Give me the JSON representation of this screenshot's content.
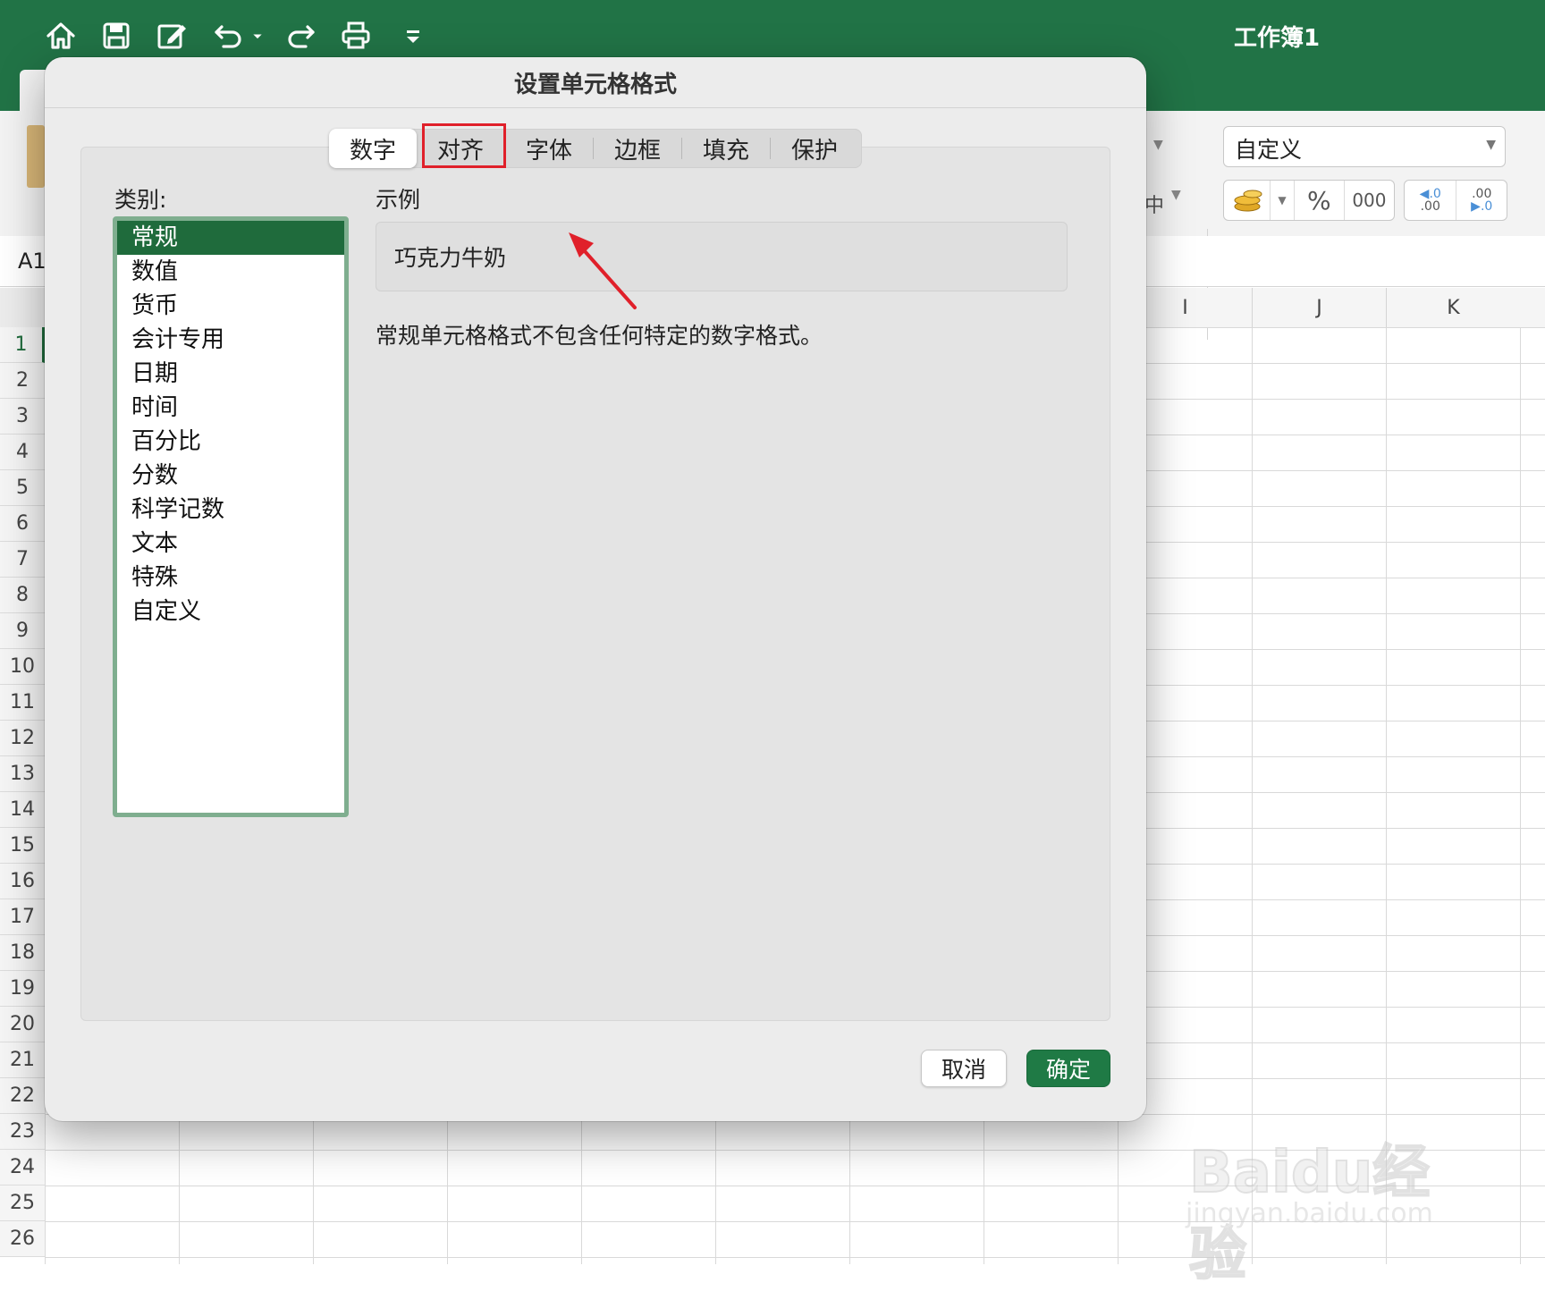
{
  "window": {
    "title": "工作簿1",
    "quick_access": [
      "home-icon",
      "save-icon",
      "edit-icon",
      "undo-icon",
      "redo-icon",
      "print-icon",
      "customize-icon"
    ]
  },
  "ribbon": {
    "number_format_value": "自定义",
    "buttons": [
      "accounting-icon",
      "%",
      "000",
      "increase-decimal-icon",
      "decrease-decimal-icon"
    ],
    "fragment_center": "中"
  },
  "formula_bar": {
    "name_box": "A1"
  },
  "grid": {
    "columns": [
      "I",
      "J",
      "K"
    ],
    "rows": [
      "1",
      "2",
      "3",
      "4",
      "5",
      "6",
      "7",
      "8",
      "9",
      "10",
      "11",
      "12",
      "13",
      "14",
      "15",
      "16",
      "17",
      "18",
      "19",
      "20",
      "21",
      "22",
      "23",
      "24",
      "25",
      "26"
    ]
  },
  "dialog": {
    "title": "设置单元格格式",
    "tabs": [
      "数字",
      "对齐",
      "字体",
      "边框",
      "填充",
      "保护"
    ],
    "selected_tab": "数字",
    "highlighted_tab": "对齐",
    "category_label": "类别:",
    "categories": [
      "常规",
      "数值",
      "货币",
      "会计专用",
      "日期",
      "时间",
      "百分比",
      "分数",
      "科学记数",
      "文本",
      "特殊",
      "自定义"
    ],
    "selected_category": "常规",
    "sample_label": "示例",
    "sample_value": "巧克力牛奶",
    "description": "常规单元格格式不包含任何特定的数字格式。",
    "cancel_label": "取消",
    "ok_label": "确定"
  },
  "watermark": {
    "main": "Baidu经验",
    "sub": "jingyan.baidu.com"
  },
  "colors": {
    "accent": "#217346",
    "selected_item": "#1f6b3c",
    "annotation": "#e0202a",
    "ok_button": "#1f7a45"
  }
}
